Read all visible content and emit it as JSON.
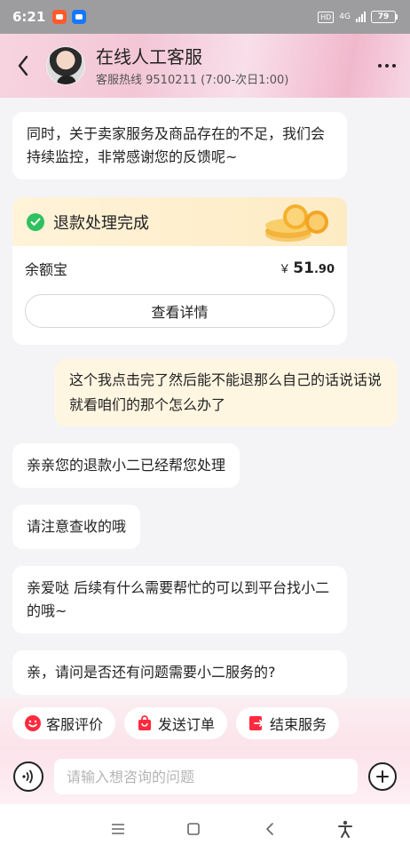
{
  "status_bar": {
    "time": "6:21",
    "hd": "HD",
    "network": "4G",
    "battery": "79"
  },
  "header": {
    "title": "在线人工客服",
    "subtitle": "客服热线 9510211 (7:00-次日1:00)"
  },
  "messages": {
    "m1": "同时，关于卖家服务及商品存在的不足，我们会持续监控，非常感谢您的反馈呢~",
    "user1": "这个我点击完了然后能不能退那么自己的话说话说就看咱们的那个怎么办了",
    "m2": "亲亲您的退款小二已经帮您处理",
    "m3": "请注意查收的哦",
    "m4": "亲爱哒 后续有什么需要帮忙的可以到平台找小二的哦~",
    "m5": "亲，请问是否还有问题需要小二服务的?"
  },
  "refund_card": {
    "title": "退款处理完成",
    "method": "余额宝",
    "currency": "￥",
    "amount_int": "51",
    "amount_dec": ".90",
    "detail_button": "查看详情"
  },
  "quick_actions": {
    "rate": "客服评价",
    "send_order": "发送订单",
    "end_service": "结束服务"
  },
  "input": {
    "placeholder": "请输入想咨询的问题"
  },
  "colors": {
    "accent_red": "#ff2a3e",
    "success_green": "#2fc05f",
    "user_bubble": "#fff6e2"
  }
}
